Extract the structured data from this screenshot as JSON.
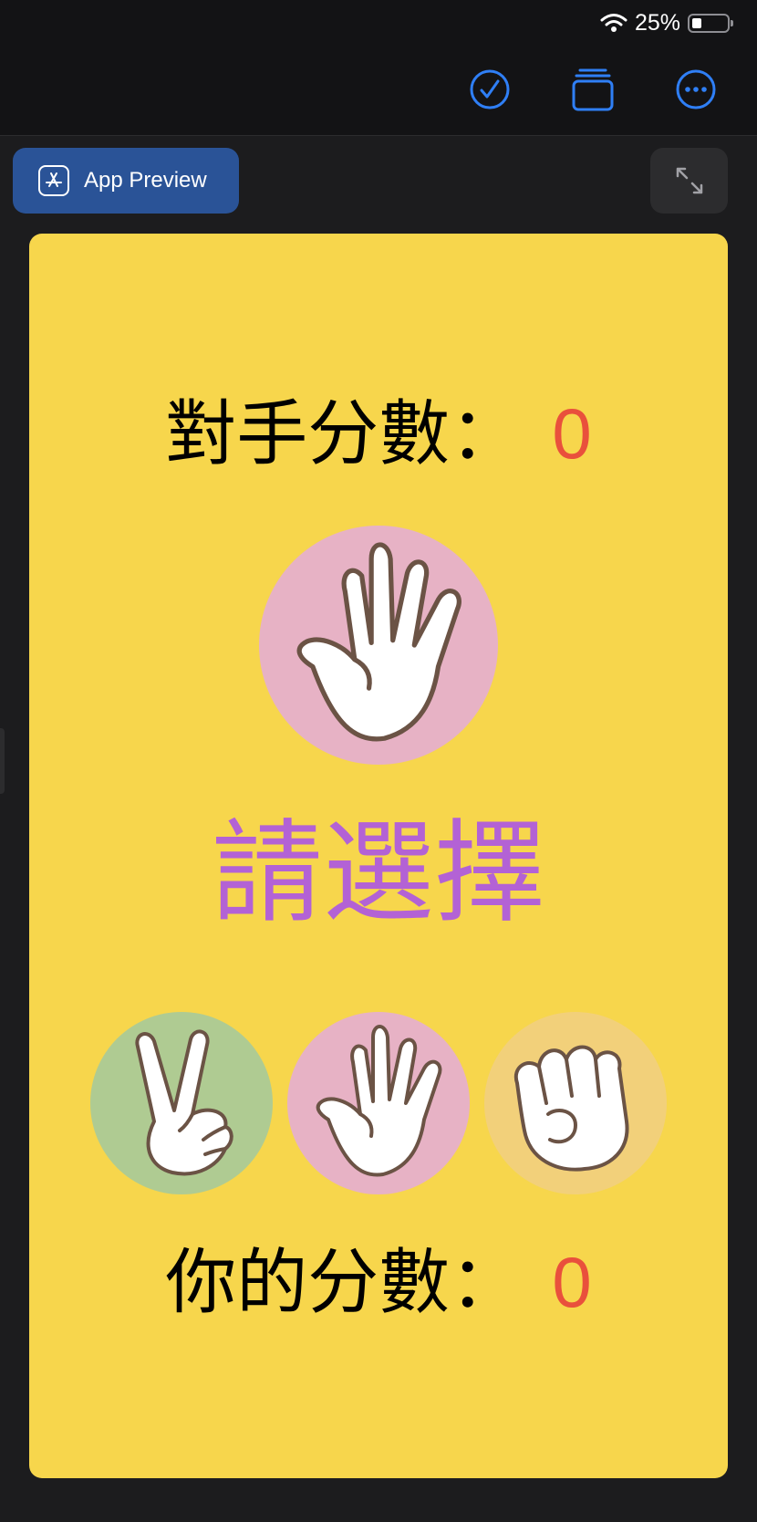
{
  "status_bar": {
    "battery": "25%",
    "icons": [
      "wifi-icon",
      "battery-icon"
    ]
  },
  "toolbar": {
    "icons": [
      "checkmark-circle-icon",
      "stack-icon",
      "more-icon"
    ]
  },
  "preview": {
    "button_label": "App Preview",
    "expand_icon": "expand-arrows-icon"
  },
  "game": {
    "opponent": {
      "label": "對手分數：",
      "score": "0",
      "hand": "paper-hand-icon"
    },
    "prompt": "請選擇",
    "choices": [
      {
        "name": "scissors",
        "icon": "scissors-hand-icon",
        "color": "#afcb92"
      },
      {
        "name": "paper",
        "icon": "paper-hand-icon",
        "color": "#e7b2c5"
      },
      {
        "name": "rock",
        "icon": "rock-hand-icon",
        "color": "#f2d07a"
      }
    ],
    "player": {
      "label": "你的分數：",
      "score": "0"
    }
  },
  "colors": {
    "card": "#f7d64c",
    "score_value": "#e9503c",
    "prompt": "#b362d5",
    "accent": "#2f7ff6"
  }
}
